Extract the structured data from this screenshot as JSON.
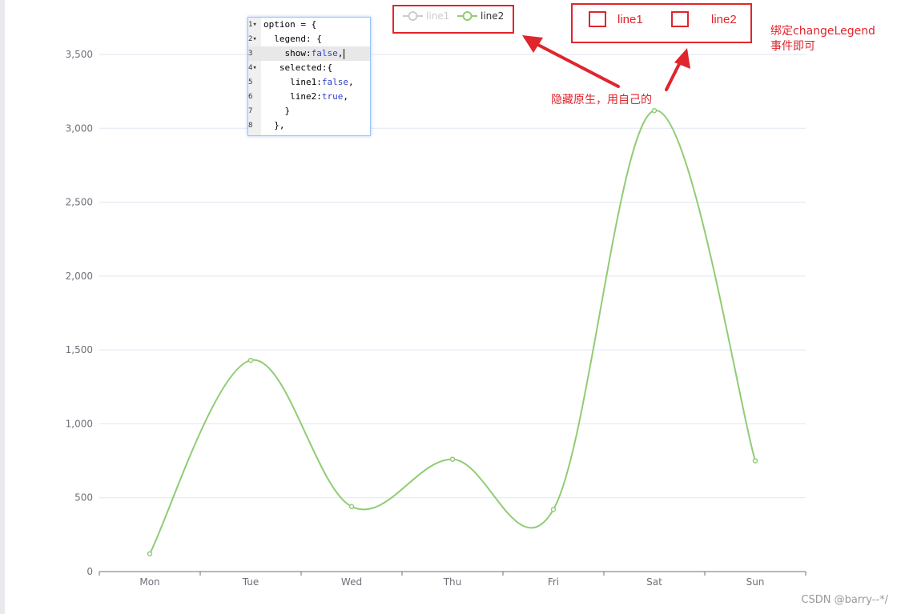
{
  "chart_data": {
    "type": "line",
    "smooth": true,
    "categories": [
      "Mon",
      "Tue",
      "Wed",
      "Thu",
      "Fri",
      "Sat",
      "Sun"
    ],
    "series": [
      {
        "name": "line2",
        "values": [
          120,
          1430,
          440,
          760,
          420,
          3120,
          750
        ],
        "color": "#91cc75"
      }
    ],
    "ylim": [
      0,
      3500
    ],
    "yticks": [
      0,
      500,
      1000,
      1500,
      2000,
      2500,
      3000,
      3500
    ],
    "ytick_labels": [
      "0",
      "500",
      "1,000",
      "1,500",
      "2,000",
      "2,500",
      "3,000",
      "3,500"
    ],
    "grid": true,
    "title": "",
    "xlabel": "",
    "ylabel": ""
  },
  "legend": {
    "items": [
      {
        "name": "line1",
        "selected": false,
        "color": "#cccccc"
      },
      {
        "name": "line2",
        "selected": true,
        "color": "#91cc75"
      }
    ]
  },
  "code_snippet": {
    "lines": [
      {
        "num": "1",
        "fold": true,
        "text": "option = {"
      },
      {
        "num": "2",
        "fold": true,
        "text": "  legend: {"
      },
      {
        "num": "3",
        "fold": false,
        "text": "    show:",
        "value": "false",
        "suffix": ",",
        "active": true
      },
      {
        "num": "4",
        "fold": true,
        "text": "   selected:{"
      },
      {
        "num": "5",
        "fold": false,
        "text": "     line1:",
        "value": "false",
        "suffix": ","
      },
      {
        "num": "6",
        "fold": false,
        "text": "     line2:",
        "value": "true",
        "suffix": ","
      },
      {
        "num": "7",
        "fold": false,
        "text": "    }"
      },
      {
        "num": "8",
        "fold": false,
        "text": "  },"
      }
    ]
  },
  "custom_legend": {
    "items": [
      {
        "label": "line1"
      },
      {
        "label": "line2"
      }
    ]
  },
  "annotations": {
    "hide_native": "隐藏原生，用自己的",
    "bind_event_line1": "绑定changeLegend",
    "bind_event_line2": "事件即可"
  },
  "watermark": "CSDN @barry--*/",
  "colors": {
    "accent_red": "#e0252d",
    "axis": "#6e7079",
    "grid": "#e0e6f1"
  }
}
